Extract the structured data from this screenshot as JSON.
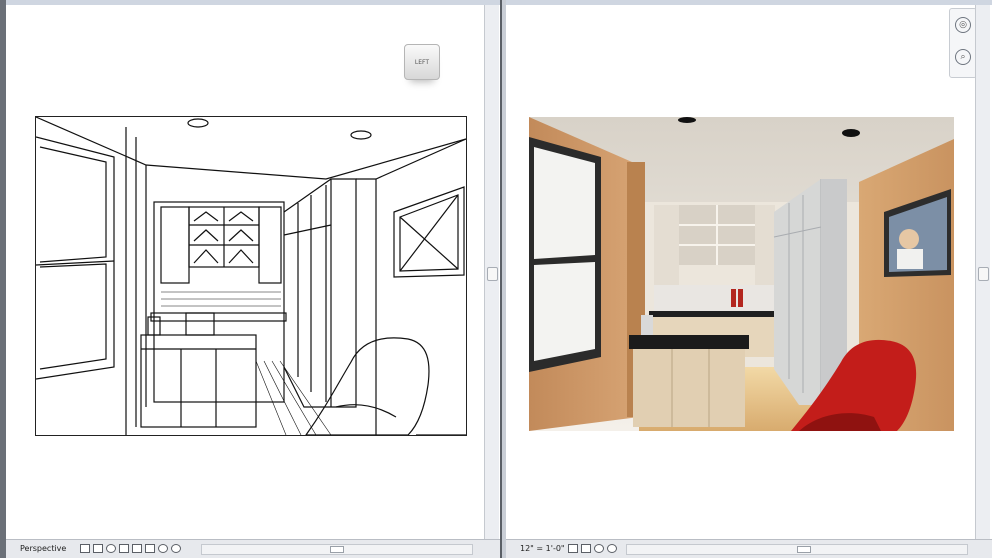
{
  "left_view": {
    "status_label": "Perspective",
    "viewcube_label": "LEFT",
    "status_icons": [
      "display-style-icon",
      "render-icon",
      "sun-path-icon",
      "shadows-icon",
      "crop-icon",
      "show-crop-icon",
      "temp-hide-icon",
      "reveal-hidden-icon"
    ]
  },
  "right_view": {
    "status_label": "12\" = 1'-0\"",
    "status_icons": [
      "display-style-icon",
      "render-icon",
      "sun-path-icon",
      "crop-icon"
    ],
    "nav_icons": [
      "steering-wheel-icon",
      "zoom-icon"
    ]
  },
  "colors": {
    "wall_orange": "#d4a06e",
    "chair_red": "#c31d1a",
    "window_frame": "#2b2b2b",
    "floor_wood": "#e8c486"
  }
}
